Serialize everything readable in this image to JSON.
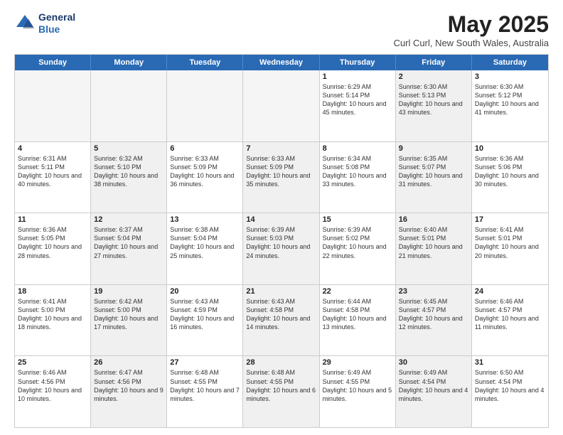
{
  "header": {
    "logo_line1": "General",
    "logo_line2": "Blue",
    "month": "May 2025",
    "location": "Curl Curl, New South Wales, Australia"
  },
  "days_of_week": [
    "Sunday",
    "Monday",
    "Tuesday",
    "Wednesday",
    "Thursday",
    "Friday",
    "Saturday"
  ],
  "rows": [
    [
      {
        "day": "",
        "text": "",
        "empty": true
      },
      {
        "day": "",
        "text": "",
        "empty": true
      },
      {
        "day": "",
        "text": "",
        "empty": true
      },
      {
        "day": "",
        "text": "",
        "empty": true
      },
      {
        "day": "1",
        "text": "Sunrise: 6:29 AM\nSunset: 5:14 PM\nDaylight: 10 hours\nand 45 minutes."
      },
      {
        "day": "2",
        "text": "Sunrise: 6:30 AM\nSunset: 5:13 PM\nDaylight: 10 hours\nand 43 minutes.",
        "shaded": true
      },
      {
        "day": "3",
        "text": "Sunrise: 6:30 AM\nSunset: 5:12 PM\nDaylight: 10 hours\nand 41 minutes."
      }
    ],
    [
      {
        "day": "4",
        "text": "Sunrise: 6:31 AM\nSunset: 5:11 PM\nDaylight: 10 hours\nand 40 minutes."
      },
      {
        "day": "5",
        "text": "Sunrise: 6:32 AM\nSunset: 5:10 PM\nDaylight: 10 hours\nand 38 minutes.",
        "shaded": true
      },
      {
        "day": "6",
        "text": "Sunrise: 6:33 AM\nSunset: 5:09 PM\nDaylight: 10 hours\nand 36 minutes."
      },
      {
        "day": "7",
        "text": "Sunrise: 6:33 AM\nSunset: 5:09 PM\nDaylight: 10 hours\nand 35 minutes.",
        "shaded": true
      },
      {
        "day": "8",
        "text": "Sunrise: 6:34 AM\nSunset: 5:08 PM\nDaylight: 10 hours\nand 33 minutes."
      },
      {
        "day": "9",
        "text": "Sunrise: 6:35 AM\nSunset: 5:07 PM\nDaylight: 10 hours\nand 31 minutes.",
        "shaded": true
      },
      {
        "day": "10",
        "text": "Sunrise: 6:36 AM\nSunset: 5:06 PM\nDaylight: 10 hours\nand 30 minutes."
      }
    ],
    [
      {
        "day": "11",
        "text": "Sunrise: 6:36 AM\nSunset: 5:05 PM\nDaylight: 10 hours\nand 28 minutes."
      },
      {
        "day": "12",
        "text": "Sunrise: 6:37 AM\nSunset: 5:04 PM\nDaylight: 10 hours\nand 27 minutes.",
        "shaded": true
      },
      {
        "day": "13",
        "text": "Sunrise: 6:38 AM\nSunset: 5:04 PM\nDaylight: 10 hours\nand 25 minutes."
      },
      {
        "day": "14",
        "text": "Sunrise: 6:39 AM\nSunset: 5:03 PM\nDaylight: 10 hours\nand 24 minutes.",
        "shaded": true
      },
      {
        "day": "15",
        "text": "Sunrise: 6:39 AM\nSunset: 5:02 PM\nDaylight: 10 hours\nand 22 minutes."
      },
      {
        "day": "16",
        "text": "Sunrise: 6:40 AM\nSunset: 5:01 PM\nDaylight: 10 hours\nand 21 minutes.",
        "shaded": true
      },
      {
        "day": "17",
        "text": "Sunrise: 6:41 AM\nSunset: 5:01 PM\nDaylight: 10 hours\nand 20 minutes."
      }
    ],
    [
      {
        "day": "18",
        "text": "Sunrise: 6:41 AM\nSunset: 5:00 PM\nDaylight: 10 hours\nand 18 minutes."
      },
      {
        "day": "19",
        "text": "Sunrise: 6:42 AM\nSunset: 5:00 PM\nDaylight: 10 hours\nand 17 minutes.",
        "shaded": true
      },
      {
        "day": "20",
        "text": "Sunrise: 6:43 AM\nSunset: 4:59 PM\nDaylight: 10 hours\nand 16 minutes."
      },
      {
        "day": "21",
        "text": "Sunrise: 6:43 AM\nSunset: 4:58 PM\nDaylight: 10 hours\nand 14 minutes.",
        "shaded": true
      },
      {
        "day": "22",
        "text": "Sunrise: 6:44 AM\nSunset: 4:58 PM\nDaylight: 10 hours\nand 13 minutes."
      },
      {
        "day": "23",
        "text": "Sunrise: 6:45 AM\nSunset: 4:57 PM\nDaylight: 10 hours\nand 12 minutes.",
        "shaded": true
      },
      {
        "day": "24",
        "text": "Sunrise: 6:46 AM\nSunset: 4:57 PM\nDaylight: 10 hours\nand 11 minutes."
      }
    ],
    [
      {
        "day": "25",
        "text": "Sunrise: 6:46 AM\nSunset: 4:56 PM\nDaylight: 10 hours\nand 10 minutes."
      },
      {
        "day": "26",
        "text": "Sunrise: 6:47 AM\nSunset: 4:56 PM\nDaylight: 10 hours\nand 9 minutes.",
        "shaded": true
      },
      {
        "day": "27",
        "text": "Sunrise: 6:48 AM\nSunset: 4:55 PM\nDaylight: 10 hours\nand 7 minutes."
      },
      {
        "day": "28",
        "text": "Sunrise: 6:48 AM\nSunset: 4:55 PM\nDaylight: 10 hours\nand 6 minutes.",
        "shaded": true
      },
      {
        "day": "29",
        "text": "Sunrise: 6:49 AM\nSunset: 4:55 PM\nDaylight: 10 hours\nand 5 minutes."
      },
      {
        "day": "30",
        "text": "Sunrise: 6:49 AM\nSunset: 4:54 PM\nDaylight: 10 hours\nand 4 minutes.",
        "shaded": true
      },
      {
        "day": "31",
        "text": "Sunrise: 6:50 AM\nSunset: 4:54 PM\nDaylight: 10 hours\nand 4 minutes."
      }
    ]
  ]
}
